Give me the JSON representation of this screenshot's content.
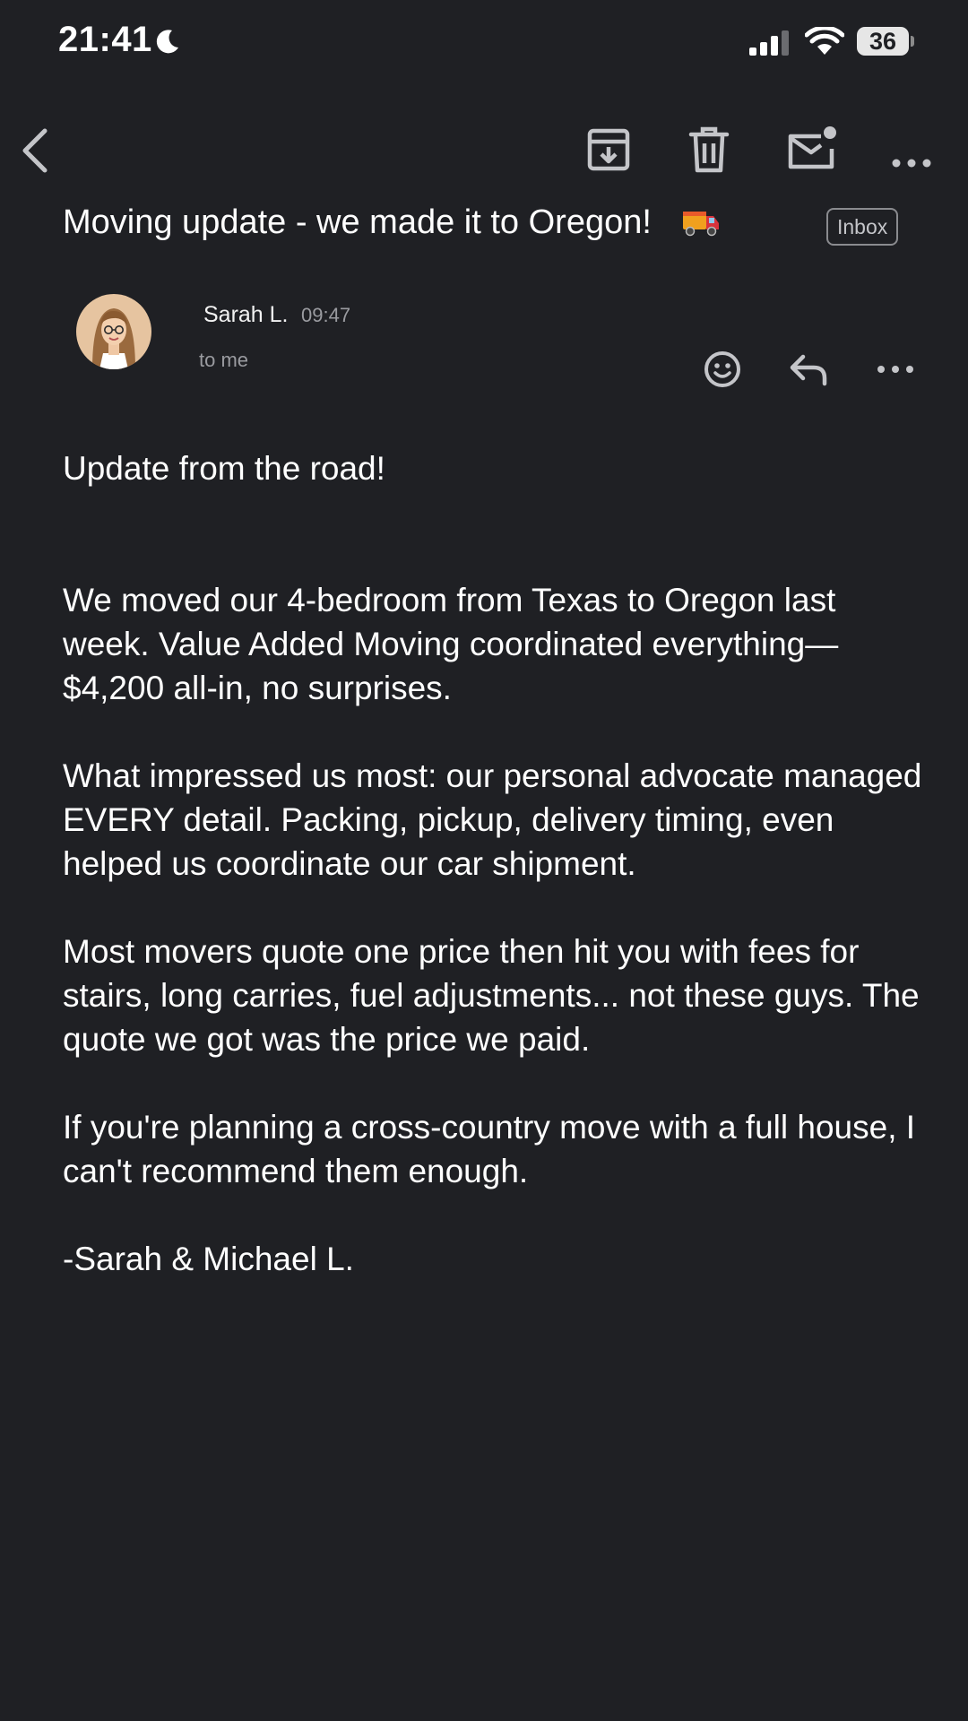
{
  "status_bar": {
    "time": "21:41",
    "battery_level": "36",
    "icons": [
      "moon-icon",
      "signal-icon",
      "wifi-icon",
      "battery-icon"
    ]
  },
  "toolbar": {
    "icons": [
      "back-arrow-icon",
      "archive-icon",
      "trash-icon",
      "mark-unread-icon",
      "more-horizontal-icon"
    ]
  },
  "email": {
    "subject": "Moving update - we made it to Oregon!",
    "subject_emoji": "truck-icon",
    "label": "Inbox",
    "sender": {
      "name": "Sarah L.",
      "time": "09:47",
      "recipient": "to me"
    },
    "message_actions": [
      "smiley-icon",
      "reply-icon",
      "more-horizontal-icon"
    ],
    "body": {
      "greeting": "Update from the road!",
      "paragraph_1": "We moved our 4-bedroom from Texas to Oregon last week. Value Added Moving coordinated everything—$4,200 all-in, no surprises.",
      "paragraph_2": "What impressed us most: our personal advocate managed EVERY detail. Packing, pickup, delivery timing, even helped us coordinate our car shipment.",
      "paragraph_3": "Most movers quote one price then hit you with fees for stairs, long carries, fuel adjustments... not these guys. The quote we got was the price we paid.",
      "paragraph_4": "If you're planning a cross-country move with a full house, I can't recommend them enough.",
      "signature": "-Sarah & Michael L."
    }
  },
  "colors": {
    "background": "#1f2024",
    "text": "#ffffff",
    "secondary_text": "#9a9ba0",
    "icon": "#c4c5c9"
  }
}
